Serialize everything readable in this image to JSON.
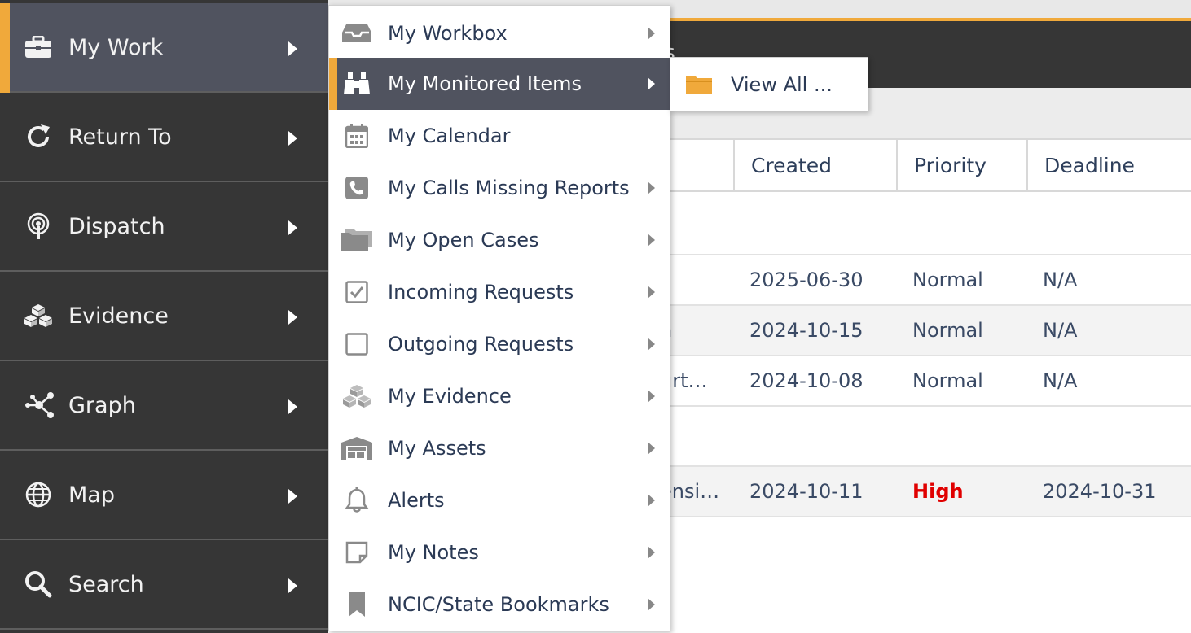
{
  "background": {
    "header_title": "ts",
    "table": {
      "columns": [
        "Created",
        "Priority",
        "Deadline"
      ],
      "rows": [
        {
          "prefix": "",
          "created": "2025-06-30",
          "priority": "Normal",
          "deadline": "N/A"
        },
        {
          "prefix": "n",
          "created": "2024-10-15",
          "priority": "Normal",
          "deadline": "N/A"
        },
        {
          "prefix": "urt…",
          "created": "2024-10-08",
          "priority": "Normal",
          "deadline": "N/A"
        },
        {
          "prefix": "ensi…",
          "created": "2024-10-11",
          "priority": "High",
          "deadline": "2024-10-31"
        }
      ]
    }
  },
  "main_menu": {
    "items": [
      {
        "label": "My Work",
        "icon": "briefcase-icon"
      },
      {
        "label": "Return To",
        "icon": "return-icon"
      },
      {
        "label": "Dispatch",
        "icon": "dispatch-icon"
      },
      {
        "label": "Evidence",
        "icon": "boxes-icon"
      },
      {
        "label": "Graph",
        "icon": "graph-icon"
      },
      {
        "label": "Map",
        "icon": "globe-icon"
      },
      {
        "label": "Search",
        "icon": "search-icon"
      }
    ]
  },
  "submenu": {
    "items": [
      {
        "label": "My Workbox",
        "icon": "inbox-icon"
      },
      {
        "label": "My Monitored Items",
        "icon": "binoculars-icon"
      },
      {
        "label": "My Calendar",
        "icon": "calendar-icon"
      },
      {
        "label": "My Calls Missing Reports",
        "icon": "phone-icon"
      },
      {
        "label": "My Open Cases",
        "icon": "folders-icon"
      },
      {
        "label": "Incoming Requests",
        "icon": "checkbox-checked-icon"
      },
      {
        "label": "Outgoing Requests",
        "icon": "checkbox-empty-icon"
      },
      {
        "label": "My Evidence",
        "icon": "boxes-icon"
      },
      {
        "label": "My Assets",
        "icon": "warehouse-icon"
      },
      {
        "label": "Alerts",
        "icon": "bell-icon"
      },
      {
        "label": "My Notes",
        "icon": "note-icon"
      },
      {
        "label": "NCIC/State Bookmarks",
        "icon": "bookmark-icon"
      }
    ]
  },
  "flyout": {
    "label": "View All ...",
    "icon": "folder-icon"
  },
  "colors": {
    "accent": "#f0a93b",
    "menu_bg": "#363636",
    "active_bg": "#50535f",
    "high_priority": "#e00000"
  }
}
